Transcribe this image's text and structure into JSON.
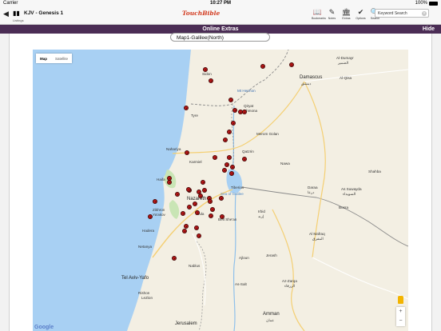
{
  "status": {
    "carrier": "Carrier",
    "wifi_icon": "wifi-icon",
    "time": "10:27 PM",
    "battery_label": "100%",
    "battery_fraction": 1.0
  },
  "toolbar": {
    "back_icon": "◀",
    "book_icon": "▮▮",
    "book_title": "KJV - Genesis 1",
    "sub_label": "Listings",
    "logo_text": "TouchBible",
    "tools": [
      {
        "icon": "📖",
        "label": "Bookmarks"
      },
      {
        "icon": "✎",
        "label": "Notes"
      },
      {
        "icon": "🏛",
        "label": "Extras"
      },
      {
        "icon": "✔",
        "label": "Options"
      },
      {
        "icon": "🔍",
        "label": "Search"
      }
    ],
    "search_placeholder": "Keyword Search",
    "clear_glyph": "✕"
  },
  "header": {
    "title": "Online Extras",
    "hide_label": "Hide",
    "color": "#4b2d55"
  },
  "map_select": {
    "value": "Map1-Galilee(North)"
  },
  "map": {
    "type_options": [
      "Map",
      "Satellite"
    ],
    "active_type": "Map",
    "zoom_in": "+",
    "zoom_out": "−",
    "attribution": "Google",
    "pin_color": "#b51616",
    "pin_count": 46,
    "labels": [
      "Sidon",
      "Damascus",
      "دمشق",
      "Al-Dumayr",
      "الضمير",
      "Al-Qisa",
      "Mt Hermon",
      "Tyre",
      "Qiryat",
      "Shmona",
      "Nahariya",
      "Karmiel",
      "Haifa",
      "Nazareth",
      "Afula",
      "Tiberias",
      "Sea of Galilee",
      "Qatzrin",
      "Merom Golan",
      "Daraa",
      "درعا",
      "Nawa",
      "As Suwayda",
      "السويداء",
      "Irbid",
      "إربد",
      "Beit She'an",
      "Zikhron",
      "Ya'akov",
      "Hadera",
      "Netanya",
      "Nablus",
      "Tel Aviv-Yafo",
      "Rishon",
      "LeZion",
      "Jerusalem",
      "Amman",
      "عمان",
      "Az-Zarqa",
      "الزرقاء",
      "Al Mafraq",
      "المفرق",
      "As-Salt",
      "Ajloun",
      "Jerash",
      "Bosra",
      "Shahba"
    ]
  }
}
